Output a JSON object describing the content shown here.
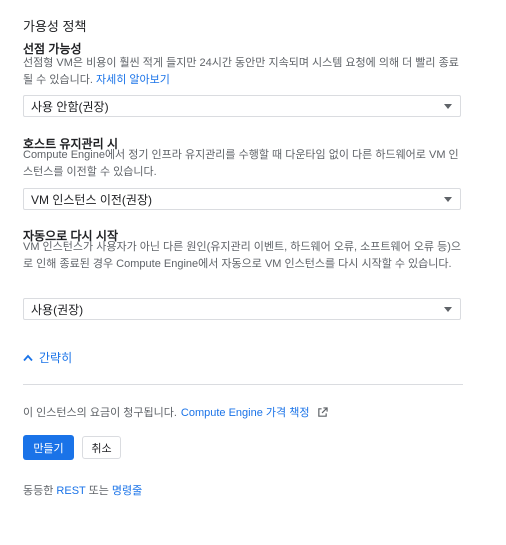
{
  "section_title": "가용성 정책",
  "preemptible": {
    "title": "선점 가능성",
    "description": "선점형 VM은 비용이 훨씬 적게 들지만 24시간 동안만 지속되며 시스템 요청에 의해 더 빨리 종료될 수 있습니다. ",
    "learn_more": "자세히 알아보기",
    "value": "사용 안함(권장)"
  },
  "host_maintenance": {
    "title": "호스트 유지관리 시",
    "description": "Compute Engine에서 정기 인프라 유지관리를 수행할 때 다운타임 없이 다른 하드웨어로 VM 인스턴스를 이전할 수 있습니다.",
    "value": "VM 인스턴스 이전(권장)"
  },
  "auto_restart": {
    "title": "자동으로 다시 시작",
    "description": "VM 인스턴스가 사용자가 아닌 다른 원인(유지관리 이벤트, 하드웨어 오류, 소프트웨어 오류 등)으로 인해 종료된 경우 Compute Engine에서 자동으로 VM 인스턴스를 다시 시작할 수 있습니다.",
    "value": "사용(권장)"
  },
  "collapse_label": "간략히",
  "billing": {
    "text": "이 인스턴스의 요금이 청구됩니다. ",
    "link": "Compute Engine 가격 책정"
  },
  "buttons": {
    "create": "만들기",
    "cancel": "취소"
  },
  "equivalent": {
    "prefix": "동등한 ",
    "rest": "REST",
    "middle": " 또는 ",
    "command_line": "명령줄"
  },
  "icons": {
    "dropdown": "caret-down-icon",
    "collapse": "chevron-up-icon",
    "external": "external-link-icon"
  },
  "colors": {
    "accent": "#1a73e8",
    "text": "#202124",
    "secondary_text": "#5f6368",
    "border": "#dadce0"
  }
}
